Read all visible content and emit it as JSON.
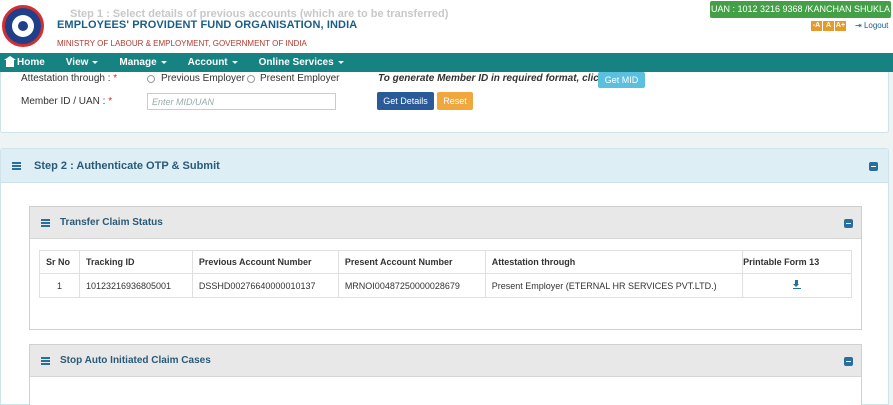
{
  "header": {
    "faded_step_text": "Step 1 : Select details of previous accounts (which are to be transferred)",
    "org_name": "EMPLOYEES' PROVIDENT FUND ORGANISATION, INDIA",
    "org_subtitle": "MINISTRY OF LABOUR & EMPLOYMENT, GOVERNMENT OF INDIA",
    "uan_badge": "UAN : 1012 3216 9368 /KANCHAN SHUKLA",
    "font_buttons": [
      "-A",
      "A",
      "A+"
    ],
    "logout_label": "Logout"
  },
  "nav": {
    "items": [
      {
        "label": "Home",
        "icon": "home-icon"
      },
      {
        "label": "View",
        "dropdown": true
      },
      {
        "label": "Manage",
        "dropdown": true
      },
      {
        "label": "Account",
        "dropdown": true
      },
      {
        "label": "Online Services",
        "dropdown": true
      }
    ]
  },
  "step1": {
    "attestation_label": "Attestation through :",
    "attestation_options": [
      "Previous Employer",
      "Present Employer"
    ],
    "hint_text": "To generate Member ID in required format, click",
    "get_mid_label": "Get MID",
    "member_id_label": "Member ID / UAN :",
    "member_id_placeholder": "Enter MID/UAN",
    "required_mark": "*",
    "get_details_label": "Get Details",
    "reset_label": "Reset"
  },
  "step2": {
    "title": "Step 2 : Authenticate OTP & Submit",
    "transfer_status": {
      "title": "Transfer Claim Status",
      "columns": [
        "Sr No",
        "Tracking ID",
        "Previous Account Number",
        "Present Account Number",
        "Attestation through",
        "Printable Form 13"
      ],
      "rows": [
        {
          "sr_no": "1",
          "tracking_id": "10123216936805001",
          "previous_account": "DSSHD00276640000010137",
          "present_account": "MRNOI00487250000028679",
          "attestation": "Present Employer (ETERNAL HR SERVICES PVT.LTD.)",
          "form_icon": "download-icon"
        }
      ]
    },
    "stop_auto": {
      "title": "Stop Auto Initiated Claim Cases"
    }
  },
  "colors": {
    "nav_bg": "#168282",
    "uan_badge_bg": "#43a047",
    "primary_button": "#2a5a98",
    "reset_button": "#f0a73d",
    "info_button": "#5bc0de"
  }
}
